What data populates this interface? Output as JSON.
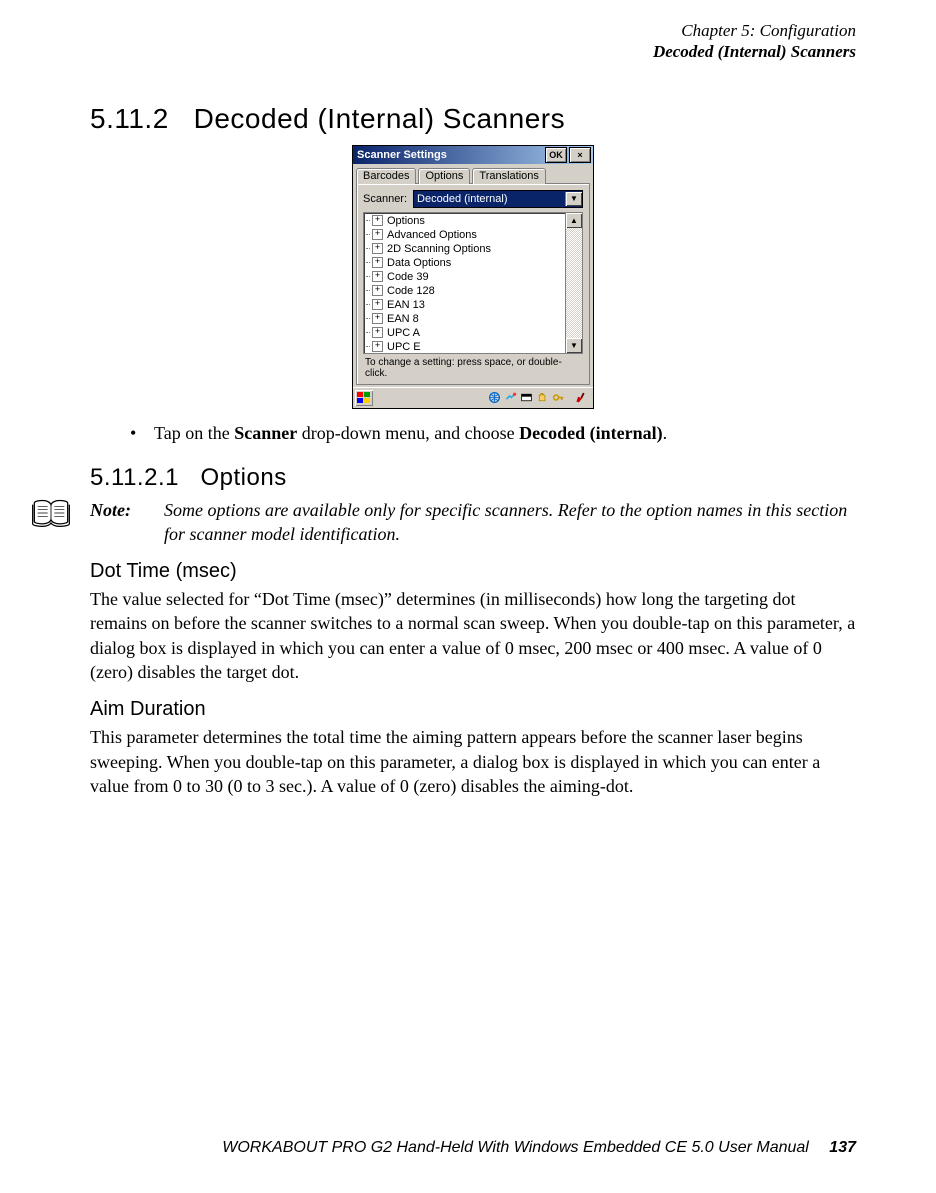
{
  "header": {
    "chapter": "Chapter 5: Configuration",
    "section_title": "Decoded (Internal) Scanners"
  },
  "sections": {
    "s1": {
      "num": "5.11.2",
      "title": "Decoded (Internal) Scanners"
    },
    "s2": {
      "num": "5.11.2.1",
      "title": "Options"
    }
  },
  "instruction": {
    "bullet": "•",
    "pre": "Tap on the ",
    "bold1": "Scanner",
    "mid": " drop-down menu, and choose ",
    "bold2": "Decoded (internal)",
    "post": "."
  },
  "note": {
    "label": "Note:",
    "text": "Some options are available only for specific scanners. Refer to the option names in this section for scanner model identification."
  },
  "subsections": {
    "dot": {
      "title": "Dot Time (msec)",
      "text": "The value selected for “Dot Time (msec)” determines (in milliseconds) how long the targeting dot remains on before the scanner switches to a normal scan sweep. When you double-tap on this parameter, a dialog box is displayed in which you can enter a value of 0 msec, 200 msec or 400 msec. A value of 0 (zero) disables the target dot."
    },
    "aim": {
      "title": "Aim Duration",
      "text": "This parameter determines the total time the aiming pattern appears before the scanner laser begins sweeping. When you double-tap on this parameter, a dialog box is displayed in which you can enter a value from 0 to 30 (0 to 3 sec.). A value of 0 (zero) disables the aiming-dot."
    }
  },
  "dialog": {
    "title": "Scanner Settings",
    "ok": "OK",
    "close": "×",
    "tabs": [
      "Barcodes",
      "Options",
      "Translations"
    ],
    "active_tab": 0,
    "scanner_label": "Scanner:",
    "scanner_value": "Decoded (internal)",
    "tree": [
      "Options",
      "Advanced Options",
      "2D Scanning Options",
      "Data Options",
      "Code 39",
      "Code 128",
      "EAN 13",
      "EAN 8",
      "UPC A",
      "UPC E"
    ],
    "hint": "To change a setting: press space, or double-click."
  },
  "footer": {
    "manual": "WORKABOUT PRO G2 Hand-Held With Windows Embedded CE 5.0 User Manual",
    "page": "137"
  }
}
